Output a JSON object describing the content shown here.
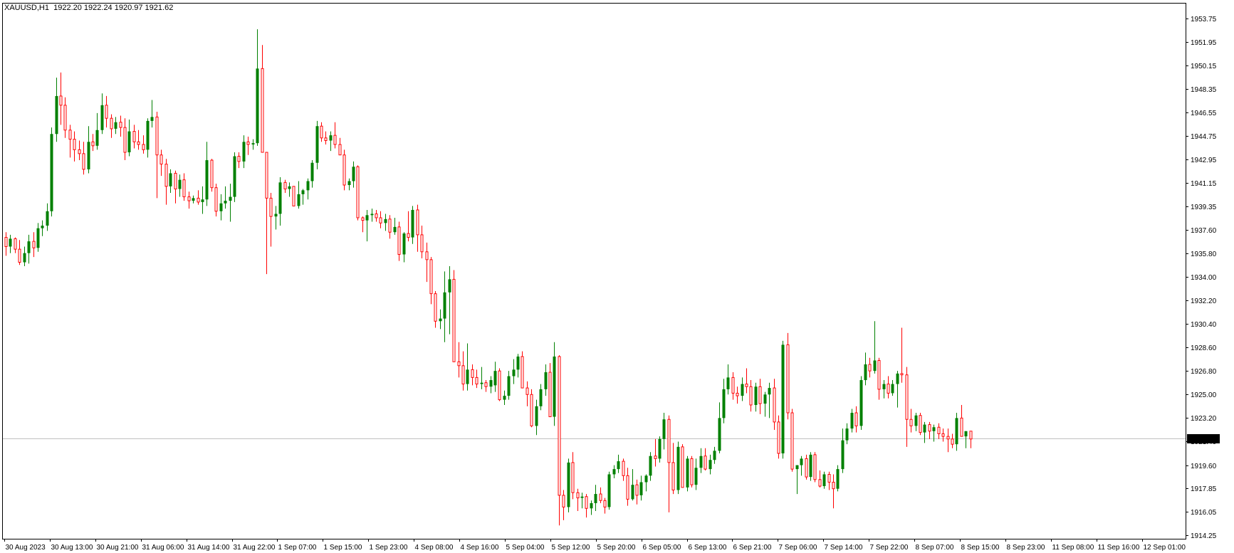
{
  "header": {
    "symbol": "XAUUSD,H1",
    "ohlc": "1922.20 1922.24 1920.97 1921.62"
  },
  "colors": {
    "background": "#ffffff",
    "bull": "#008000",
    "bear": "#ff0000",
    "frame": "#000000",
    "grid": "#000000",
    "price_line": "#c0c0c0",
    "price_tag_bg": "#000000",
    "price_tag_text": "#ffffff"
  },
  "chart_data": {
    "type": "candlestick",
    "symbol": "XAUUSD",
    "timeframe": "H1",
    "current_price": 1921.62,
    "current_price_label": "1921.62",
    "ylim": [
      1913.9,
      1955.0
    ],
    "y_ticks": [
      "1953.75",
      "1951.95",
      "1950.15",
      "1948.35",
      "1946.55",
      "1944.75",
      "1942.95",
      "1941.15",
      "1939.35",
      "1937.60",
      "1935.80",
      "1934.00",
      "1932.20",
      "1930.40",
      "1928.60",
      "1926.80",
      "1925.00",
      "1923.20",
      "1921.40",
      "1919.60",
      "1917.85",
      "1916.05",
      "1914.25"
    ],
    "x_labels": [
      "30 Aug 2023",
      "30 Aug 13:00",
      "30 Aug 21:00",
      "31 Aug 06:00",
      "31 Aug 14:00",
      "31 Aug 22:00",
      "1 Sep 07:00",
      "1 Sep 15:00",
      "1 Sep 23:00",
      "4 Sep 08:00",
      "4 Sep 16:00",
      "5 Sep 04:00",
      "5 Sep 12:00",
      "5 Sep 20:00",
      "6 Sep 05:00",
      "6 Sep 13:00",
      "6 Sep 21:00",
      "7 Sep 06:00",
      "7 Sep 14:00",
      "7 Sep 22:00",
      "8 Sep 07:00",
      "8 Sep 15:00",
      "8 Sep 23:00",
      "11 Sep 08:00",
      "11 Sep 16:00",
      "12 Sep 01:00"
    ],
    "candles": [
      [
        1937.0,
        1937.4,
        1935.6,
        1936.3
      ],
      [
        1936.3,
        1937.2,
        1935.8,
        1936.9
      ],
      [
        1936.9,
        1937.0,
        1935.8,
        1936.1
      ],
      [
        1936.1,
        1936.8,
        1934.9,
        1935.1
      ],
      [
        1935.1,
        1936.3,
        1934.8,
        1935.8
      ],
      [
        1935.8,
        1937.2,
        1935.0,
        1936.7
      ],
      [
        1936.7,
        1937.4,
        1935.5,
        1936.2
      ],
      [
        1936.2,
        1938.1,
        1935.9,
        1937.7
      ],
      [
        1937.7,
        1938.3,
        1937.1,
        1937.9
      ],
      [
        1937.9,
        1939.6,
        1937.5,
        1939.0
      ],
      [
        1939.0,
        1945.4,
        1938.6,
        1944.9
      ],
      [
        1944.9,
        1949.2,
        1944.3,
        1947.8
      ],
      [
        1947.8,
        1949.6,
        1945.6,
        1947.1
      ],
      [
        1947.1,
        1947.7,
        1944.6,
        1945.2
      ],
      [
        1945.2,
        1945.6,
        1943.1,
        1944.5
      ],
      [
        1944.5,
        1945.1,
        1942.8,
        1943.7
      ],
      [
        1943.7,
        1944.4,
        1942.9,
        1943.4
      ],
      [
        1943.4,
        1944.3,
        1941.8,
        1942.2
      ],
      [
        1942.2,
        1945.5,
        1941.9,
        1944.3
      ],
      [
        1944.3,
        1944.9,
        1943.6,
        1944.0
      ],
      [
        1944.0,
        1946.5,
        1943.7,
        1945.2
      ],
      [
        1945.2,
        1948.0,
        1944.9,
        1947.1
      ],
      [
        1947.1,
        1947.8,
        1945.4,
        1946.1
      ],
      [
        1946.1,
        1946.4,
        1944.6,
        1945.3
      ],
      [
        1945.3,
        1946.2,
        1944.9,
        1945.8
      ],
      [
        1945.8,
        1946.3,
        1944.7,
        1945.4
      ],
      [
        1945.4,
        1946.1,
        1942.9,
        1943.5
      ],
      [
        1943.5,
        1946.0,
        1943.2,
        1945.1
      ],
      [
        1945.1,
        1945.6,
        1943.8,
        1944.3
      ],
      [
        1944.3,
        1945.2,
        1943.7,
        1944.1
      ],
      [
        1944.1,
        1944.8,
        1943.4,
        1943.7
      ],
      [
        1943.7,
        1946.1,
        1943.1,
        1945.9
      ],
      [
        1945.9,
        1947.5,
        1945.4,
        1946.2
      ],
      [
        1946.2,
        1946.6,
        1940.0,
        1943.3
      ],
      [
        1943.3,
        1943.7,
        1941.7,
        1942.6
      ],
      [
        1942.6,
        1943.0,
        1939.5,
        1940.9
      ],
      [
        1940.9,
        1942.2,
        1940.4,
        1941.9
      ],
      [
        1941.9,
        1942.1,
        1939.6,
        1940.7
      ],
      [
        1940.7,
        1941.8,
        1940.1,
        1941.4
      ],
      [
        1941.4,
        1941.9,
        1939.8,
        1940.1
      ],
      [
        1940.1,
        1940.5,
        1939.2,
        1939.8
      ],
      [
        1939.8,
        1940.2,
        1939.6,
        1940.0
      ],
      [
        1940.0,
        1940.6,
        1939.5,
        1939.7
      ],
      [
        1939.7,
        1940.9,
        1938.8,
        1939.9
      ],
      [
        1939.9,
        1944.3,
        1939.4,
        1942.9
      ],
      [
        1942.9,
        1943.0,
        1940.5,
        1940.8
      ],
      [
        1940.8,
        1941.1,
        1938.6,
        1939.0
      ],
      [
        1939.0,
        1940.3,
        1938.3,
        1939.6
      ],
      [
        1939.6,
        1940.9,
        1939.2,
        1939.8
      ],
      [
        1939.8,
        1941.1,
        1938.2,
        1940.1
      ],
      [
        1940.1,
        1943.5,
        1939.7,
        1943.2
      ],
      [
        1943.2,
        1943.5,
        1942.3,
        1942.8
      ],
      [
        1942.8,
        1944.8,
        1942.3,
        1944.3
      ],
      [
        1944.3,
        1944.7,
        1943.3,
        1944.1
      ],
      [
        1944.1,
        1944.5,
        1943.7,
        1944.2
      ],
      [
        1944.2,
        1952.9,
        1944.0,
        1949.9
      ],
      [
        1949.9,
        1951.7,
        1943.9,
        1943.5
      ],
      [
        1943.5,
        1943.5,
        1934.2,
        1940.0
      ],
      [
        1940.0,
        1940.4,
        1936.3,
        1938.6
      ],
      [
        1938.6,
        1939.4,
        1937.6,
        1938.8
      ],
      [
        1938.8,
        1941.6,
        1937.9,
        1941.2
      ],
      [
        1941.2,
        1941.4,
        1940.4,
        1940.7
      ],
      [
        1940.7,
        1941.2,
        1940.1,
        1940.9
      ],
      [
        1940.9,
        1940.8,
        1939.4,
        1939.4
      ],
      [
        1939.4,
        1941.3,
        1939.2,
        1940.3
      ],
      [
        1940.3,
        1940.7,
        1939.5,
        1940.6
      ],
      [
        1940.6,
        1941.5,
        1939.9,
        1941.3
      ],
      [
        1941.3,
        1942.9,
        1940.8,
        1942.7
      ],
      [
        1942.7,
        1945.9,
        1942.2,
        1945.5
      ],
      [
        1945.5,
        1945.8,
        1944.3,
        1944.6
      ],
      [
        1944.6,
        1945.1,
        1944.1,
        1944.4
      ],
      [
        1944.4,
        1945.1,
        1943.6,
        1944.8
      ],
      [
        1944.8,
        1945.8,
        1943.8,
        1944.1
      ],
      [
        1944.1,
        1944.6,
        1943.5,
        1943.3
      ],
      [
        1943.3,
        1943.7,
        1940.6,
        1941.0
      ],
      [
        1941.0,
        1941.5,
        1940.6,
        1941.3
      ],
      [
        1941.3,
        1942.8,
        1940.8,
        1942.4
      ],
      [
        1942.4,
        1942.5,
        1938.3,
        1938.5
      ],
      [
        1938.5,
        1938.6,
        1937.4,
        1938.3
      ],
      [
        1938.3,
        1939.1,
        1936.7,
        1938.7
      ],
      [
        1938.7,
        1939.2,
        1938.2,
        1938.8
      ],
      [
        1938.8,
        1939.1,
        1938.2,
        1938.5
      ],
      [
        1938.5,
        1939.0,
        1937.7,
        1938.1
      ],
      [
        1938.1,
        1938.8,
        1937.5,
        1938.4
      ],
      [
        1938.4,
        1938.7,
        1936.9,
        1937.4
      ],
      [
        1937.4,
        1938.5,
        1937.2,
        1937.8
      ],
      [
        1937.8,
        1938.2,
        1935.2,
        1935.7
      ],
      [
        1935.7,
        1937.4,
        1935.1,
        1937.3
      ],
      [
        1937.3,
        1939.0,
        1936.7,
        1937.0
      ],
      [
        1937.0,
        1939.4,
        1936.5,
        1939.1
      ],
      [
        1939.1,
        1939.5,
        1935.9,
        1937.2
      ],
      [
        1937.2,
        1937.9,
        1935.4,
        1935.9
      ],
      [
        1935.9,
        1936.6,
        1933.6,
        1935.3
      ],
      [
        1935.3,
        1935.5,
        1931.9,
        1932.7
      ],
      [
        1932.7,
        1932.9,
        1930.1,
        1930.6
      ],
      [
        1930.6,
        1931.5,
        1930.0,
        1930.8
      ],
      [
        1930.8,
        1934.4,
        1929.0,
        1932.8
      ],
      [
        1932.8,
        1934.8,
        1929.6,
        1933.8
      ],
      [
        1933.8,
        1934.5,
        1927.6,
        1927.5
      ],
      [
        1927.5,
        1929.0,
        1926.3,
        1927.2
      ],
      [
        1927.2,
        1928.3,
        1925.3,
        1925.8
      ],
      [
        1925.8,
        1928.9,
        1925.3,
        1926.9
      ],
      [
        1926.9,
        1927.3,
        1925.7,
        1926.3
      ],
      [
        1926.3,
        1926.9,
        1925.5,
        1925.8
      ],
      [
        1925.8,
        1927.1,
        1925.4,
        1925.9
      ],
      [
        1925.9,
        1926.1,
        1925.2,
        1925.6
      ],
      [
        1925.6,
        1926.4,
        1925.1,
        1926.1
      ],
      [
        1925.7,
        1927.5,
        1925.2,
        1926.8
      ],
      [
        1926.8,
        1927.0,
        1924.5,
        1924.6
      ],
      [
        1924.6,
        1925.3,
        1924.2,
        1924.9
      ],
      [
        1924.9,
        1926.8,
        1924.6,
        1926.4
      ],
      [
        1926.4,
        1927.7,
        1925.8,
        1926.9
      ],
      [
        1926.9,
        1928.1,
        1926.3,
        1927.9
      ],
      [
        1927.9,
        1928.3,
        1925.8,
        1925.5
      ],
      [
        1925.5,
        1926.0,
        1924.1,
        1925.0
      ],
      [
        1925.0,
        1925.4,
        1922.5,
        1922.6
      ],
      [
        1922.6,
        1924.6,
        1921.9,
        1924.1
      ],
      [
        1924.1,
        1925.8,
        1923.8,
        1925.4
      ],
      [
        1925.4,
        1927.3,
        1924.9,
        1926.7
      ],
      [
        1926.7,
        1927.4,
        1923.3,
        1923.3
      ],
      [
        1923.3,
        1929.0,
        1922.6,
        1927.9
      ],
      [
        1927.9,
        1928.0,
        1915.0,
        1917.3
      ],
      [
        1917.3,
        1917.7,
        1915.4,
        1916.4
      ],
      [
        1916.4,
        1920.1,
        1916.0,
        1919.8
      ],
      [
        1919.8,
        1920.6,
        1917.0,
        1917.5
      ],
      [
        1917.5,
        1917.8,
        1916.1,
        1917.1
      ],
      [
        1917.1,
        1917.5,
        1916.3,
        1917.2
      ],
      [
        1917.2,
        1917.4,
        1915.6,
        1916.3
      ],
      [
        1916.3,
        1916.9,
        1915.8,
        1916.7
      ],
      [
        1916.7,
        1918.1,
        1916.1,
        1917.4
      ],
      [
        1917.4,
        1917.9,
        1916.7,
        1916.9
      ],
      [
        1916.9,
        1917.1,
        1915.9,
        1916.4
      ],
      [
        1916.4,
        1919.1,
        1916.2,
        1918.9
      ],
      [
        1918.9,
        1919.6,
        1918.6,
        1919.3
      ],
      [
        1919.3,
        1920.4,
        1919.0,
        1919.9
      ],
      [
        1919.9,
        1920.1,
        1918.4,
        1918.8
      ],
      [
        1918.8,
        1919.4,
        1916.5,
        1917.0
      ],
      [
        1917.0,
        1919.3,
        1916.9,
        1918.1
      ],
      [
        1918.1,
        1918.5,
        1916.6,
        1917.3
      ],
      [
        1917.3,
        1918.8,
        1916.9,
        1918.3
      ],
      [
        1918.3,
        1918.9,
        1917.6,
        1918.8
      ],
      [
        1918.8,
        1920.6,
        1918.4,
        1920.3
      ],
      [
        1920.3,
        1921.6,
        1919.5,
        1920.1
      ],
      [
        1920.1,
        1921.8,
        1919.8,
        1921.6
      ],
      [
        1921.6,
        1923.6,
        1920.8,
        1923.1
      ],
      [
        1923.1,
        1923.4,
        1916.0,
        1919.8
      ],
      [
        1919.8,
        1921.3,
        1917.4,
        1917.7
      ],
      [
        1917.7,
        1921.4,
        1917.4,
        1921.0
      ],
      [
        1921.0,
        1921.2,
        1917.9,
        1917.9
      ],
      [
        1917.9,
        1920.3,
        1917.6,
        1920.1
      ],
      [
        1920.1,
        1920.3,
        1917.9,
        1918.1
      ],
      [
        1918.1,
        1920.1,
        1917.7,
        1919.4
      ],
      [
        1919.4,
        1920.9,
        1919.0,
        1920.3
      ],
      [
        1920.3,
        1920.9,
        1919.2,
        1919.3
      ],
      [
        1919.3,
        1920.4,
        1918.9,
        1920.0
      ],
      [
        1920.0,
        1921.0,
        1919.7,
        1920.7
      ],
      [
        1920.7,
        1924.4,
        1920.5,
        1923.2
      ],
      [
        1923.2,
        1926.2,
        1922.8,
        1925.4
      ],
      [
        1925.4,
        1927.3,
        1925.0,
        1926.3
      ],
      [
        1926.3,
        1926.7,
        1924.6,
        1925.1
      ],
      [
        1925.1,
        1925.6,
        1924.3,
        1924.9
      ],
      [
        1924.9,
        1926.3,
        1924.5,
        1925.8
      ],
      [
        1925.8,
        1927.0,
        1925.1,
        1925.6
      ],
      [
        1925.6,
        1926.1,
        1923.7,
        1924.2
      ],
      [
        1924.2,
        1925.9,
        1923.7,
        1925.6
      ],
      [
        1925.6,
        1926.2,
        1923.5,
        1924.3
      ],
      [
        1924.3,
        1925.2,
        1923.3,
        1925.0
      ],
      [
        1925.0,
        1925.9,
        1923.2,
        1925.5
      ],
      [
        1925.5,
        1926.2,
        1922.3,
        1922.9
      ],
      [
        1922.9,
        1923.4,
        1920.1,
        1920.5
      ],
      [
        1920.5,
        1929.1,
        1920.1,
        1928.8
      ],
      [
        1928.8,
        1929.7,
        1923.1,
        1923.6
      ],
      [
        1923.6,
        1923.9,
        1919.1,
        1919.3
      ],
      [
        1919.3,
        1919.6,
        1917.4,
        1919.6
      ],
      [
        1919.6,
        1920.3,
        1918.8,
        1920.1
      ],
      [
        1920.1,
        1920.4,
        1918.5,
        1918.7
      ],
      [
        1918.7,
        1920.6,
        1918.4,
        1920.4
      ],
      [
        1920.4,
        1920.6,
        1918.3,
        1918.5
      ],
      [
        1918.5,
        1919.2,
        1917.9,
        1918.0
      ],
      [
        1918.0,
        1919.1,
        1917.8,
        1918.9
      ],
      [
        1918.9,
        1919.1,
        1917.7,
        1918.3
      ],
      [
        1918.3,
        1918.9,
        1916.3,
        1917.8
      ],
      [
        1917.8,
        1919.6,
        1917.6,
        1919.3
      ],
      [
        1919.3,
        1922.4,
        1919.0,
        1921.5
      ],
      [
        1921.5,
        1922.8,
        1921.2,
        1922.4
      ],
      [
        1922.4,
        1923.9,
        1922.1,
        1923.6
      ],
      [
        1923.6,
        1924.1,
        1922.1,
        1922.6
      ],
      [
        1922.6,
        1926.4,
        1922.3,
        1926.1
      ],
      [
        1926.1,
        1928.2,
        1925.7,
        1927.3
      ],
      [
        1927.3,
        1927.8,
        1926.3,
        1926.8
      ],
      [
        1926.8,
        1930.6,
        1926.6,
        1927.6
      ],
      [
        1927.6,
        1927.8,
        1924.6,
        1925.4
      ],
      [
        1925.4,
        1926.1,
        1924.7,
        1925.8
      ],
      [
        1925.8,
        1926.4,
        1924.7,
        1925.1
      ],
      [
        1925.1,
        1926.1,
        1924.9,
        1925.8
      ],
      [
        1925.8,
        1926.8,
        1924.0,
        1926.6
      ],
      [
        1926.6,
        1930.1,
        1925.9,
        1926.5
      ],
      [
        1926.5,
        1927.1,
        1921.0,
        1923.1
      ],
      [
        1923.1,
        1923.9,
        1922.1,
        1922.6
      ],
      [
        1922.6,
        1923.6,
        1922.2,
        1923.4
      ],
      [
        1923.4,
        1923.6,
        1921.9,
        1922.1
      ],
      [
        1922.1,
        1922.9,
        1921.3,
        1922.7
      ],
      [
        1922.7,
        1922.9,
        1921.6,
        1922.2
      ],
      [
        1922.2,
        1922.7,
        1921.4,
        1922.5
      ],
      [
        1922.5,
        1922.8,
        1921.6,
        1922.0
      ],
      [
        1922.0,
        1922.4,
        1921.4,
        1921.8
      ],
      [
        1921.8,
        1922.4,
        1920.6,
        1921.6
      ],
      [
        1921.6,
        1922.0,
        1920.9,
        1921.2
      ],
      [
        1921.2,
        1923.6,
        1920.7,
        1923.2
      ],
      [
        1923.2,
        1924.2,
        1922.1,
        1921.8
      ],
      [
        1921.8,
        1922.2,
        1920.9,
        1922.2
      ],
      [
        1922.2,
        1922.2,
        1920.9,
        1921.6
      ]
    ]
  }
}
